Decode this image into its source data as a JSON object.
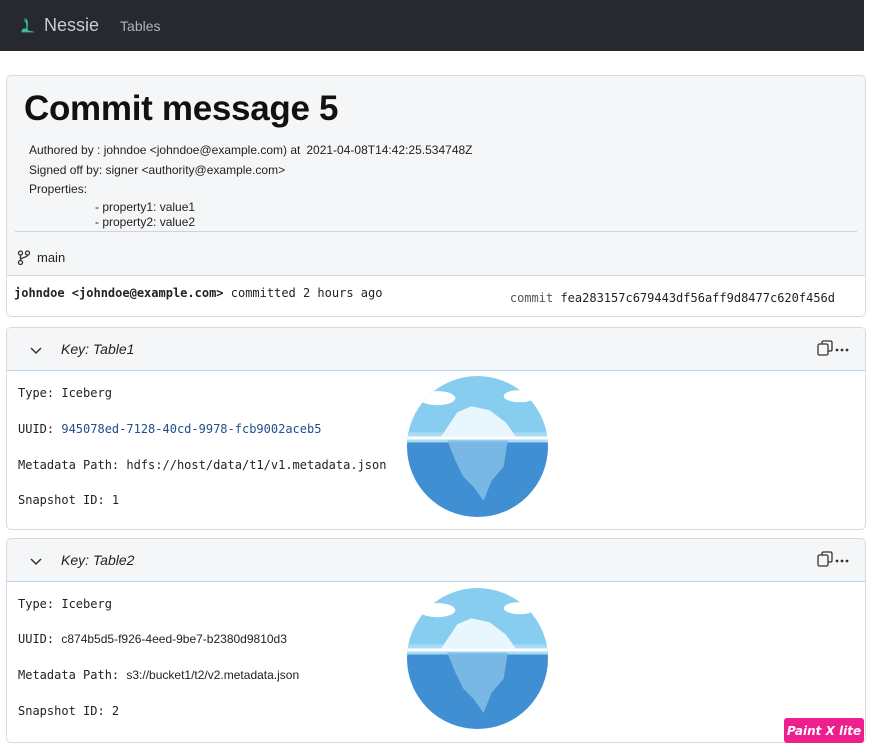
{
  "nav": {
    "brand": "Nessie",
    "links": [
      "Tables"
    ]
  },
  "commit": {
    "title": "Commit message 5",
    "authored_by_prefix": "Authored by : johndoe <johndoe@example.com) at",
    "authored_time": "2021-04-08T14:42:25.534748Z",
    "signed_off": "Signed off by: signer <authority@example.com>",
    "properties_label": "Properties:",
    "properties": [
      "- property1: value1",
      "- property2: value2"
    ],
    "branch": "main",
    "author_bold": "johndoe <johndoe@example.com>",
    "committed_text": " committed 2 hours ago",
    "hash_label": "commit",
    "hash": "fea283157c679443df56aff9d8477c620f456d"
  },
  "tables": [
    {
      "key_label": "Key: Table1",
      "type_line": "Type: Iceberg",
      "uuid_label": "UUID: ",
      "uuid_value": "945078ed-7128-40cd-9978-fcb9002aceb5",
      "metadata_label": "Metadata Path: ",
      "metadata_value": "hdfs://host/data/t1/v1.metadata.json",
      "snapshot_line": "Snapshot ID: 1"
    },
    {
      "key_label": "Key:  Table2",
      "type_line": "Type: Iceberg",
      "uuid_label": "UUID: ",
      "uuid_value": "c874b5d5-f926-4eed-9be7-b2380d9810d3",
      "metadata_label": "Metadata Path: ",
      "metadata_value": "s3://bucket1/t2/v2.metadata.json",
      "snapshot_line": "Snapshot ID: 2"
    }
  ],
  "badge": "Paint X lite",
  "colors": {
    "navbar": "#262a2f",
    "uuid_link": "#1f4f8f",
    "badge": "#ee1e8d"
  },
  "icons": [
    "nessie-logo-icon",
    "git-branch-icon",
    "chevron-down-icon",
    "copy-icon",
    "more-icon",
    "iceberg-icon"
  ]
}
